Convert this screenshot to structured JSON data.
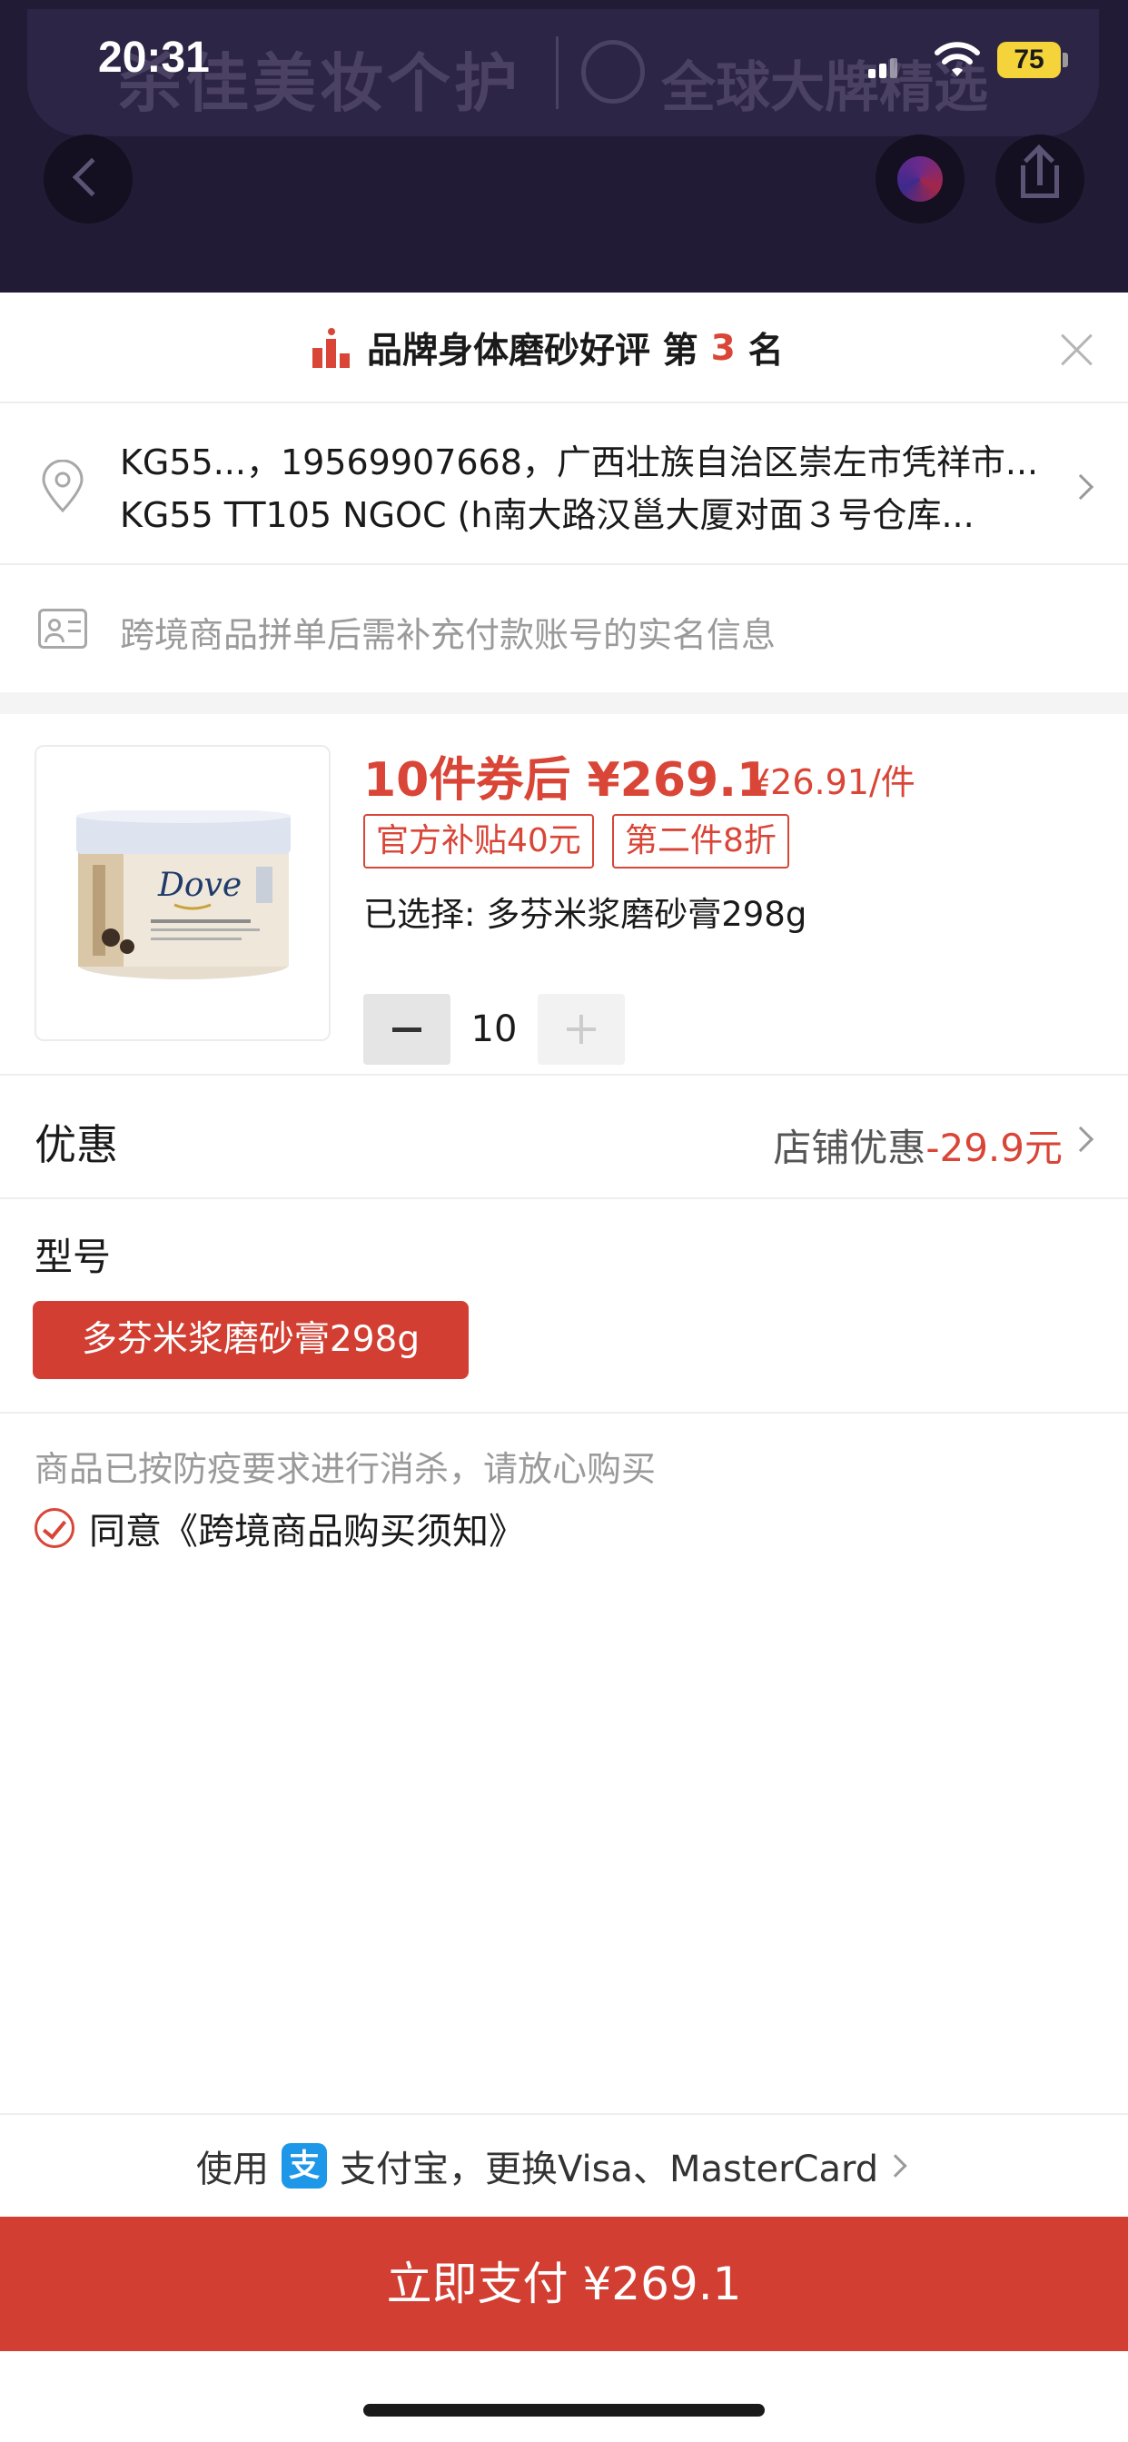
{
  "status_bar": {
    "time": "20:31",
    "battery": "75"
  },
  "background": {
    "banner_title": "杀佳美妆个护",
    "banner_subtitle": "全球大牌精选"
  },
  "rank": {
    "prefix": "品牌身体磨砂好评 第",
    "number": "3",
    "suffix": "名"
  },
  "address": {
    "line1": "KG55...，19569907668，广西壮族自治区崇左市凭祥市...",
    "line2": "KG55 TT105 NGOC (h南大路汉邕大厦对面３号仓库..."
  },
  "identity_notice": "跨境商品拼单后需补充付款账号的实名信息",
  "product": {
    "price_main": "10件券后 ¥269.1",
    "price_unit": "¥26.91/件",
    "tags": [
      "官方补贴40元",
      "第二件8折"
    ],
    "selected": "已选择: 多芬米浆磨砂膏298g",
    "quantity": "10"
  },
  "discount": {
    "label": "优惠",
    "store_label": "店铺优惠",
    "amount": "-29.9元"
  },
  "model": {
    "label": "型号",
    "option": "多芬米浆磨砂膏298g"
  },
  "notice": "商品已按防疫要求进行消杀，请放心购买",
  "agreement": "同意《跨境商品购买须知》",
  "payment": {
    "use_label": "使用",
    "method_text": "支付宝，更换Visa、MasterCard"
  },
  "pay_button": "立即支付 ¥269.1",
  "colors": {
    "accent_red": "#d23e31",
    "alipay_blue": "#1e97e8",
    "header_dark": "#221b35"
  }
}
